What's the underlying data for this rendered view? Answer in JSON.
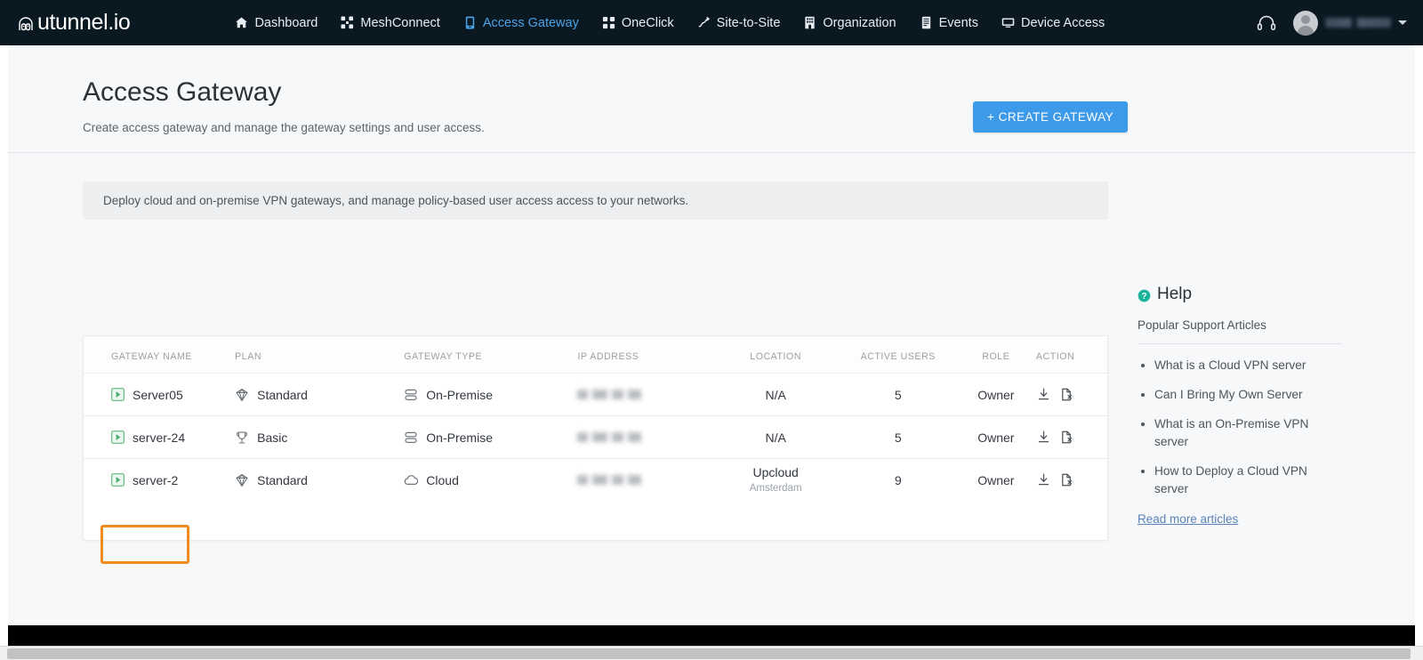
{
  "navbar": {
    "logo_text": "utunnel.io",
    "logo_icon": "tunnel-lock-icon",
    "links": [
      {
        "label": "Dashboard",
        "icon": "home-icon",
        "active": false
      },
      {
        "label": "MeshConnect",
        "icon": "mesh-icon",
        "active": false
      },
      {
        "label": "Access Gateway",
        "icon": "gateway-icon",
        "active": true
      },
      {
        "label": "OneClick",
        "icon": "oneclick-icon",
        "active": false
      },
      {
        "label": "Site-to-Site",
        "icon": "site-to-site-icon",
        "active": false
      },
      {
        "label": "Organization",
        "icon": "building-icon",
        "active": false
      },
      {
        "label": "Events",
        "icon": "events-icon",
        "active": false
      },
      {
        "label": "Device Access",
        "icon": "monitor-icon",
        "active": false
      }
    ],
    "support_icon": "headset-icon",
    "user": {
      "avatar_icon": "avatar",
      "name": "",
      "caret_icon": "chevron-down-icon"
    },
    "active_color": "#4aa3e8",
    "background_color": "#0a1822"
  },
  "header": {
    "title": "Access Gateway",
    "subtitle": "Create access gateway and manage the gateway settings and user access.",
    "create_button": "+ CREATE GATEWAY",
    "create_button_color": "#3c9ae8"
  },
  "banner": {
    "text": "Deploy cloud and on-premise VPN gateways, and manage policy-based user access access to your networks."
  },
  "table": {
    "columns": [
      "GATEWAY NAME",
      "PLAN",
      "GATEWAY TYPE",
      "IP ADDRESS",
      "LOCATION",
      "ACTIVE USERS",
      "ROLE",
      "ACTION"
    ],
    "rows": [
      {
        "status_icon": "gateway-active-icon",
        "name": "Server05",
        "plan": "Standard",
        "plan_icon": "gem-icon",
        "type": "On-Premise",
        "type_icon": "server-stack-icon",
        "ip": "",
        "ip_masked": true,
        "location": "N/A",
        "location_sub": "",
        "active_users": "5",
        "role": "Owner",
        "actions": [
          "download-icon",
          "file-remove-icon"
        ],
        "highlighted": false
      },
      {
        "status_icon": "gateway-active-icon",
        "name": "server-24",
        "plan": "Basic",
        "plan_icon": "trophy-icon",
        "type": "On-Premise",
        "type_icon": "server-stack-icon",
        "ip": "",
        "ip_masked": true,
        "location": "N/A",
        "location_sub": "",
        "active_users": "5",
        "role": "Owner",
        "actions": [
          "download-icon",
          "file-remove-icon"
        ],
        "highlighted": false
      },
      {
        "status_icon": "gateway-active-icon",
        "name": "server-2",
        "plan": "Standard",
        "plan_icon": "gem-icon",
        "type": "Cloud",
        "type_icon": "cloud-icon",
        "ip": "",
        "ip_masked": true,
        "location": "Upcloud",
        "location_sub": "Amsterdam",
        "active_users": "9",
        "role": "Owner",
        "actions": [
          "download-icon",
          "file-remove-icon"
        ],
        "highlighted": true
      }
    ],
    "highlight_color": "#ef8b1f"
  },
  "help": {
    "title": "Help",
    "icon": "help-circle-icon",
    "subtitle": "Popular Support Articles",
    "articles": [
      "What is a Cloud VPN server",
      "Can I Bring My Own Server",
      "What is an On-Premise VPN server",
      "How to Deploy a Cloud VPN server"
    ],
    "read_more": "Read more articles"
  }
}
